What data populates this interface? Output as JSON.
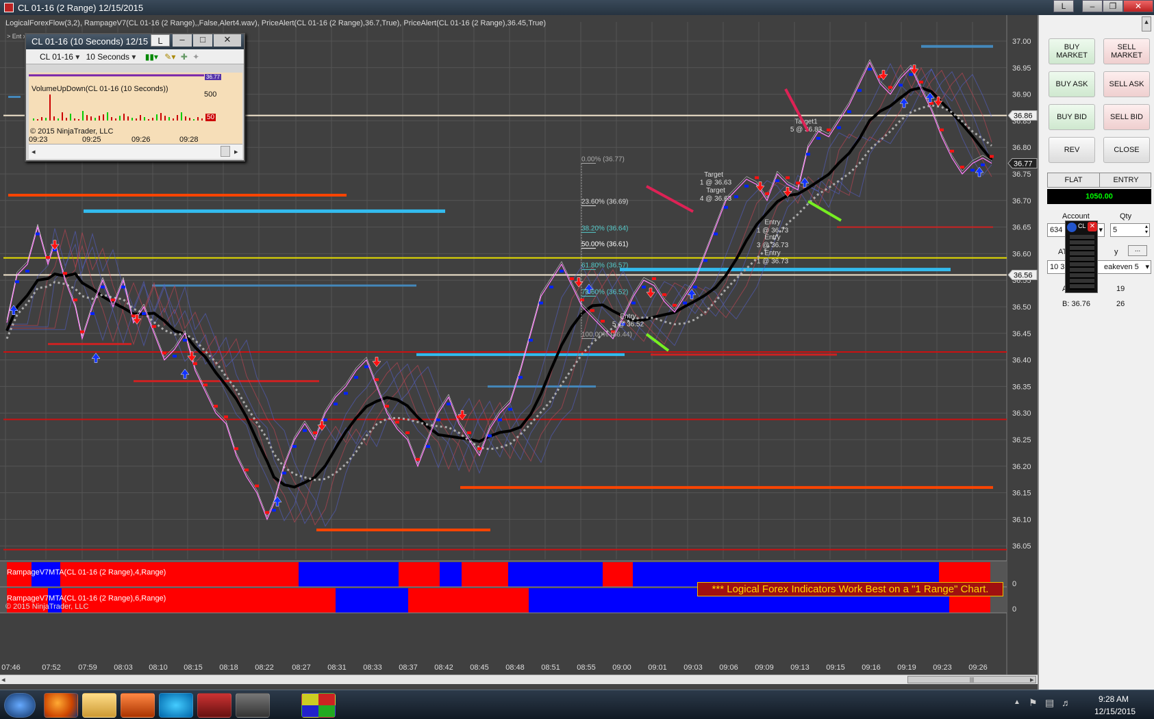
{
  "window": {
    "title": "CL 01-16 (2 Range)  12/15/2015",
    "btn_left": "L",
    "btn_min": "–",
    "btn_max": "❐",
    "btn_close": "✕"
  },
  "indicators_line": "LogicalForexFlow(3,2), RampageV7(CL 01-16 (2 Range),,False,Alert4.wav), PriceAlert(CL 01-16 (2 Range),36.7,True), PriceAlert(CL 01-16 (2 Range),36.45,True)",
  "indicators_sub": "> Ent                                                                                       x\" Names Trademarked.",
  "mini_chart": {
    "title": "CL 01-16 (10 Seconds)  12/15",
    "btn_left": "L",
    "instrument": "CL 01-16",
    "interval": "10 Seconds",
    "indicator": "VolumeUpDown(CL 01-16 (10 Seconds))",
    "copyright": "© 2015 NinjaTrader, LLC",
    "axis_500": "500",
    "axis_price": "36.77",
    "axis_vol": "50",
    "times": [
      "09:23",
      "09:25",
      "09:26",
      "09:28"
    ]
  },
  "price_axis": {
    "labels": [
      "37.00",
      "36.95",
      "36.90",
      "36.85",
      "36.80",
      "36.75",
      "36.70",
      "36.65",
      "36.60",
      "36.55",
      "36.50",
      "36.45",
      "36.40",
      "36.35",
      "36.30",
      "36.25",
      "36.20",
      "36.15",
      "36.10",
      "36.05"
    ],
    "marker_white": "36.86",
    "marker_dark": "36.77",
    "marker_lower": "36.56"
  },
  "time_axis": [
    "07:46",
    "07:52",
    "07:59",
    "08:03",
    "08:10",
    "08:15",
    "08:18",
    "08:22",
    "08:27",
    "08:31",
    "08:33",
    "08:37",
    "08:42",
    "08:45",
    "08:48",
    "08:51",
    "08:55",
    "09:00",
    "09:01",
    "09:03",
    "09:06",
    "09:09",
    "09:13",
    "09:15",
    "09:16",
    "09:19",
    "09:23",
    "09:26"
  ],
  "fib": [
    "0.00% (36.77)",
    "23.60% (36.69)",
    "38.20% (36.64)",
    "50.00% (36.61)",
    "61.80% (36.57)",
    "78.60% (36.52)",
    "100.00% (36.44)"
  ],
  "annotations": {
    "target1": "Target1",
    "target1_val": "5 @ 36.83",
    "target_a": "Target",
    "target_a_val": "1 @ 36.63",
    "target_b": "Target",
    "target_b_val": "4 @ 36.63",
    "entry1": "Entry",
    "entry1_val": "1 @ 36.73",
    "entry2": "Entry",
    "entry2_val": "3 @ 36.73",
    "entry3": "Entry",
    "entry3_val": "1 @ 36.73",
    "entry4": "Entry",
    "entry4_val": "5 @ 36.52"
  },
  "banner": "*** Logical Forex Indicators Work Best on a \"1 Range\" Chart.",
  "subpanels": {
    "p1_label": "RampageV7MTA(CL 01-16 (2 Range),4,Range)",
    "p1_zero": "0",
    "p2_label": "RampageV7MTA(CL 01-16 (2 Range),6,Range)",
    "p2_zero": "0",
    "copyright": "© 2015 NinjaTrader, LLC"
  },
  "order_panel": {
    "buy_market": "BUY\nMARKET",
    "sell_market": "SELL\nMARKET",
    "buy_ask": "BUY ASK",
    "sell_ask": "SELL ASK",
    "buy_bid": "BUY BID",
    "sell_bid": "SELL BID",
    "rev": "REV",
    "close": "CLOSE",
    "flat": "FLAT",
    "entry": "ENTRY",
    "pnl": "1050.00",
    "account_label": "Account",
    "qty_label": "Qty",
    "account_value": "634",
    "qty_value": "5",
    "atm_label": "AT",
    "atm_suffix": "y",
    "atm_value": "10 3",
    "breakeven": "eakeven 5",
    "a_label": "A",
    "a_value": "19",
    "b_label": "B: 36.76",
    "b_value": "26",
    "cl_label": "CL",
    "more": "..."
  },
  "taskbar": {
    "time": "9:28 AM",
    "date": "12/15/2015"
  },
  "colors": {
    "bg": "#404040",
    "up": "#0000ff",
    "down": "#ff0000",
    "pnl_bg": "#000000",
    "pnl_fg": "#00ff00",
    "banner": "#ffd700"
  }
}
